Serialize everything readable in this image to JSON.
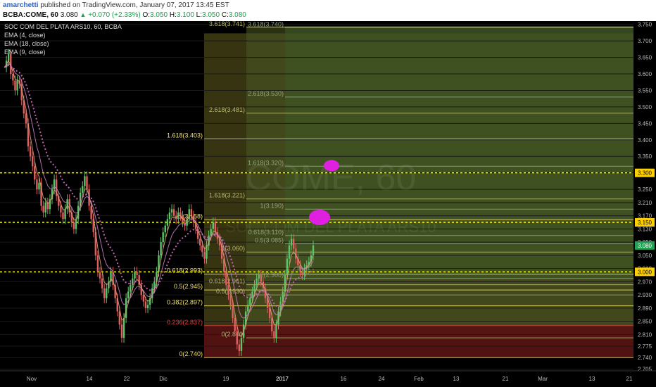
{
  "header": {
    "author": "amarchetti",
    "published": "published on TradingView.com, January 07, 2017 13:45 EST",
    "symbol": "BCBA:COME, 60",
    "last": "3.080",
    "change": "+0.070 (+2.33%)",
    "o_label": "O:",
    "o": "3.050",
    "h_label": "H:",
    "h": "3.100",
    "l_label": "L:",
    "l": "3.050",
    "c_label": "C:",
    "c": "3.080"
  },
  "legend": {
    "title": "SOC COM DEL PLATA ARS10, 60, BCBA",
    "ema1": "EMA (4, close)",
    "ema2": "EMA (18, close)",
    "ema3": "EMA (9, close)"
  },
  "watermark": {
    "symbol": "COME, 60",
    "name": "SOC COM DEL PLATA ARS10"
  },
  "colors": {
    "background": "#000000",
    "candle_up": "#5ec46a",
    "candle_down": "#e06060",
    "ema": "#d070c0",
    "dotted_line": "#ffff00",
    "fib_line": "#9aa050",
    "fib_green_zone": "#3e5a26",
    "fib_olive_zone": "#3d3a14",
    "fib_red_zone": "#5a1414",
    "marker": "#e020e0",
    "price_tag_yellow": "#ffd000",
    "price_tag_green": "#22a352"
  },
  "chart_data": {
    "type": "line",
    "title": "SOC COM DEL PLATA ARS10, 60, BCBA",
    "ylim": [
      2.7,
      3.76
    ],
    "y_axis_ticks": [
      "3.750",
      "3.700",
      "3.650",
      "3.600",
      "3.550",
      "3.500",
      "3.450",
      "3.400",
      "3.350",
      "3.300",
      "3.250",
      "3.210",
      "3.170",
      "3.130",
      "3.090",
      "3.050",
      "3.010",
      "2.970",
      "2.930",
      "2.890",
      "2.850",
      "2.810",
      "2.775",
      "2.740",
      "2.705"
    ],
    "x_axis_ticks": [
      "Nov",
      "14",
      "22",
      "Dic",
      "19",
      "2017",
      "16",
      "24",
      "Feb",
      "13",
      "21",
      "Mar",
      "13",
      "21"
    ],
    "price_tags": [
      {
        "label": "3.300",
        "value": 3.3,
        "color": "#ffd000"
      },
      {
        "label": "3.150",
        "value": 3.15,
        "color": "#ffd000"
      },
      {
        "label": "3.080",
        "value": 3.08,
        "color": "#22a352"
      },
      {
        "label": "3.000",
        "value": 3.0,
        "color": "#ffd000"
      }
    ],
    "horizontal_lines": [
      3.3,
      3.15,
      3.0
    ],
    "fib_levels_a": [
      {
        "label": "1.618(3.403)",
        "value": 3.403
      },
      {
        "label": "1(3.158)",
        "value": 3.158
      },
      {
        "label": "0.618(2.993)",
        "value": 2.993
      },
      {
        "label": "0.5(2.945)",
        "value": 2.945
      },
      {
        "label": "0.382(2.897)",
        "value": 2.897
      },
      {
        "label": "0.236(2.837)",
        "value": 2.837
      },
      {
        "label": "0(2.740)",
        "value": 2.74
      }
    ],
    "fib_levels_b": [
      {
        "label": "3.618(3.741)",
        "value": 3.741
      },
      {
        "label": "2.618(3.481)",
        "value": 3.481
      },
      {
        "label": "1.618(3.221)",
        "value": 3.221
      },
      {
        "label": "1(3.060)",
        "value": 3.06
      },
      {
        "label": "0.618(2.961)",
        "value": 2.961
      },
      {
        "label": "0.5(2.930)",
        "value": 2.93
      },
      {
        "label": "0(2.800)",
        "value": 2.8
      }
    ],
    "fib_levels_c": [
      {
        "label": "3.618(3.740)",
        "value": 3.74
      },
      {
        "label": "2.618(3.530)",
        "value": 3.53
      },
      {
        "label": "1.618(3.320)",
        "value": 3.32
      },
      {
        "label": "1(3.190)",
        "value": 3.19
      },
      {
        "label": "0.618(3.110)",
        "value": 3.11
      },
      {
        "label": "0.5(3.085)",
        "value": 3.085
      },
      {
        "label": "0(2.980)",
        "value": 2.98
      }
    ],
    "price_series": [
      3.62,
      3.64,
      3.66,
      3.6,
      3.58,
      3.55,
      3.58,
      3.57,
      3.52,
      3.48,
      3.45,
      3.38,
      3.35,
      3.32,
      3.28,
      3.25,
      3.27,
      3.2,
      3.18,
      3.21,
      3.19,
      3.22,
      3.25,
      3.28,
      3.23,
      3.2,
      3.18,
      3.16,
      3.19,
      3.22,
      3.18,
      3.15,
      3.13,
      3.16,
      3.2,
      3.24,
      3.26,
      3.29,
      3.25,
      3.2,
      3.16,
      3.12,
      3.05,
      3.0,
      2.98,
      2.95,
      2.92,
      2.95,
      2.97,
      3.0,
      2.96,
      2.92,
      2.88,
      2.84,
      2.8,
      2.86,
      2.92,
      2.94,
      2.96,
      2.98,
      3.0,
      2.99,
      2.96,
      2.93,
      2.91,
      2.89,
      2.9,
      2.92,
      2.95,
      2.97,
      3.0,
      3.05,
      3.09,
      3.12,
      3.14,
      3.16,
      3.18,
      3.19,
      3.17,
      3.16,
      3.18,
      3.17,
      3.15,
      3.14,
      3.16,
      3.19,
      3.17,
      3.15,
      3.13,
      3.1,
      3.08,
      3.06,
      3.04,
      3.08,
      3.11,
      3.13,
      3.15,
      3.12,
      3.1,
      3.08,
      3.04,
      3.0,
      2.96,
      2.93,
      2.9,
      2.86,
      2.82,
      2.78,
      2.76,
      2.8,
      2.84,
      2.88,
      2.9,
      2.92,
      2.94,
      2.96,
      2.98,
      2.99,
      2.97,
      2.95,
      2.92,
      2.89,
      2.86,
      2.82,
      2.8,
      2.84,
      2.88,
      2.91,
      2.94,
      2.99,
      3.04,
      3.08,
      3.1,
      3.07,
      3.04,
      3.02,
      3.0,
      2.99,
      3.01,
      3.02,
      3.03,
      3.05,
      3.08
    ]
  }
}
